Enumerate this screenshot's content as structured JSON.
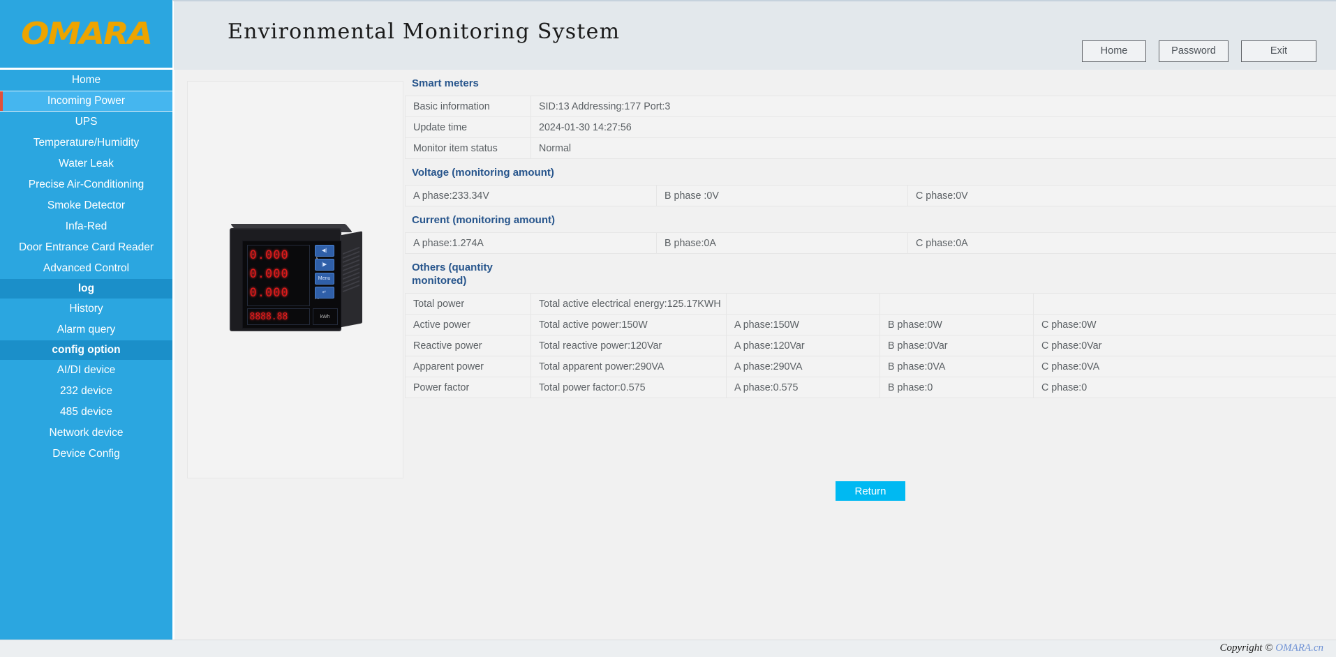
{
  "brand": {
    "logo_text": "OMARA",
    "logo_color": "#eda400"
  },
  "header": {
    "title": "Environmental Monitoring System",
    "buttons": [
      {
        "label": "Home",
        "name": "home-button"
      },
      {
        "label": "Password",
        "name": "password-button"
      },
      {
        "label": "Exit",
        "name": "exit-button"
      }
    ]
  },
  "sidebar": {
    "items": [
      {
        "label": "Home",
        "type": "item",
        "active": false
      },
      {
        "label": "Incoming Power",
        "type": "item",
        "active": true
      },
      {
        "label": "UPS",
        "type": "item",
        "active": false
      },
      {
        "label": "Temperature/Humidity",
        "type": "item",
        "active": false
      },
      {
        "label": "Water Leak",
        "type": "item",
        "active": false
      },
      {
        "label": "Precise Air-Conditioning",
        "type": "item",
        "active": false
      },
      {
        "label": "Smoke Detector",
        "type": "item",
        "active": false
      },
      {
        "label": "Infa-Red",
        "type": "item",
        "active": false
      },
      {
        "label": "Door Entrance Card Reader",
        "type": "item",
        "active": false
      },
      {
        "label": "Advanced Control",
        "type": "item",
        "active": false
      },
      {
        "label": "log",
        "type": "group",
        "active": false
      },
      {
        "label": "History",
        "type": "item",
        "active": false
      },
      {
        "label": "Alarm query",
        "type": "item",
        "active": false
      },
      {
        "label": "config option",
        "type": "group",
        "active": false
      },
      {
        "label": "AI/DI device",
        "type": "item",
        "active": false
      },
      {
        "label": "232 device",
        "type": "item",
        "active": false
      },
      {
        "label": "485 device",
        "type": "item",
        "active": false
      },
      {
        "label": "Network device",
        "type": "item",
        "active": false
      },
      {
        "label": "Device Config",
        "type": "item",
        "active": false
      }
    ]
  },
  "device_image": {
    "alt": "digital-panel-power-meter",
    "display_lines": [
      "0.000",
      "0.000",
      "0.000"
    ],
    "display_unit": "A",
    "display_bottom": "8888.88",
    "keys": [
      "◀|",
      "|▶",
      "Menu",
      "↵"
    ],
    "logo": "kWh"
  },
  "main": {
    "sections": [
      {
        "title": "Smart meters",
        "name": "smart-meters-section",
        "rows": [
          [
            "Basic information",
            "SID:13   Addressing:177   Port:3"
          ],
          [
            "Update time",
            "2024-01-30 14:27:56"
          ],
          [
            "Monitor item status",
            "Normal"
          ]
        ],
        "status_row_index": 2,
        "status_color": "#3a8f3a"
      },
      {
        "title": "Voltage (monitoring amount)",
        "name": "voltage-section",
        "rows": [
          [
            "A phase:233.34V",
            "B phase :0V",
            "C phase:0V"
          ]
        ]
      },
      {
        "title": "Current (monitoring amount)",
        "name": "current-section",
        "rows": [
          [
            "A phase:1.274A",
            "B phase:0A",
            "C phase:0A"
          ]
        ]
      },
      {
        "title": "Others (quantity monitored)",
        "name": "others-section",
        "rows": [
          [
            "Total power",
            "Total active electrical energy:125.17KWH",
            "",
            "",
            ""
          ],
          [
            "Active power",
            "Total active power:150W",
            "A phase:150W",
            "B phase:0W",
            "C phase:0W"
          ],
          [
            "Reactive power",
            "Total reactive power:120Var",
            "A phase:120Var",
            "B phase:0Var",
            "C phase:0Var"
          ],
          [
            "Apparent power",
            "Total apparent power:290VA",
            "A phase:290VA",
            "B phase:0VA",
            "C phase:0VA"
          ],
          [
            "Power factor",
            "Total power factor:0.575",
            "A phase:0.575",
            "B phase:0",
            "C phase:0"
          ]
        ]
      }
    ],
    "return_button": "Return"
  },
  "footer": {
    "copyright": "Copyright ©",
    "brand": "OMARA.cn"
  },
  "colors": {
    "sidebar_blue": "#2ba6e0",
    "sidebar_active": "#45b6ef",
    "sidebar_group": "#1b8fc9",
    "accent_cyan": "#00b9f2",
    "section_title": "#27558c",
    "status_green": "#3a8f3a",
    "header_bg": "#e3e8ec"
  }
}
